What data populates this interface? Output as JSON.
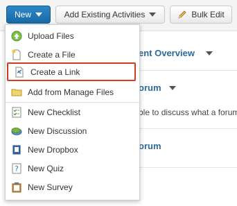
{
  "toolbar": {
    "new_label": "New",
    "add_existing_label": "Add Existing Activities",
    "bulk_edit_label": "Bulk Edit"
  },
  "background": {
    "line1": "ent Overview",
    "line2": "orum",
    "line3": "ble to discuss what a forum",
    "line4": "orum"
  },
  "menu": {
    "items": [
      {
        "label": "Upload Files",
        "icon": "upload-icon"
      },
      {
        "label": "Create a File",
        "icon": "new-file-icon"
      },
      {
        "label": "Create a Link",
        "icon": "link-icon"
      },
      {
        "label": "Add from Manage Files",
        "icon": "folder-icon"
      },
      {
        "label": "New Checklist",
        "icon": "checklist-icon"
      },
      {
        "label": "New Discussion",
        "icon": "discussion-icon"
      },
      {
        "label": "New Dropbox",
        "icon": "dropbox-icon"
      },
      {
        "label": "New Quiz",
        "icon": "quiz-icon"
      },
      {
        "label": "New Survey",
        "icon": "survey-icon"
      }
    ],
    "highlighted_index": 2
  },
  "colors": {
    "primary": "#1f78b9",
    "highlight_border": "#d9391e",
    "link_text": "#2a6a9a"
  }
}
